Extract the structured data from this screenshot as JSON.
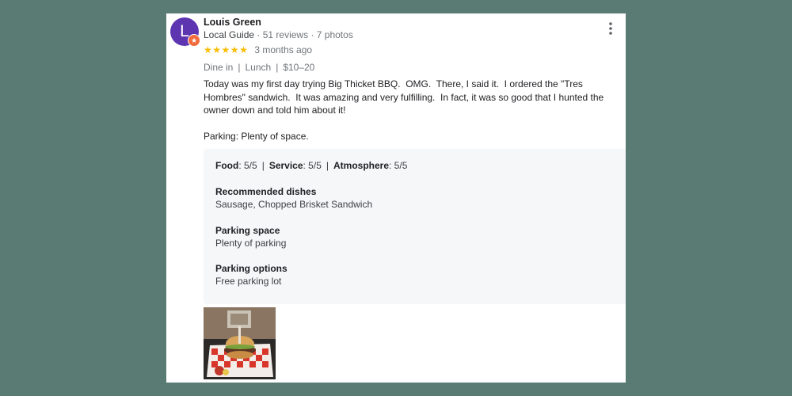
{
  "reviewer": {
    "name": "Louis Green",
    "avatar_letter": "L",
    "guide_label": "Local Guide",
    "separator1": "·",
    "reviews": "51 reviews",
    "separator2": "·",
    "photos": "7 photos"
  },
  "rating": {
    "stars": 5,
    "max_stars": 5,
    "time_ago": "3 months ago"
  },
  "tags": {
    "service": "Dine in",
    "meal": "Lunch",
    "price": "$10–20",
    "separator": "|"
  },
  "review_text": "Today was my first day trying Big Thicket BBQ.  OMG.  There, I said it.  I ordered the \"Tres Hombres\" sandwich.  It was amazing and very fulfilling.  In fact, it was so good that I hunted the owner down and told him about it!",
  "parking_note": "Parking: Plenty of space.",
  "scores": {
    "food_label": "Food",
    "food_value": ": 5/5",
    "service_label": "Service",
    "service_value": ": 5/5",
    "atmosphere_label": "Atmosphere",
    "atmosphere_value": ": 5/5",
    "separator": "|"
  },
  "details": [
    {
      "title": "Recommended dishes",
      "value": "Sausage, Chopped Brisket Sandwich"
    },
    {
      "title": "Parking space",
      "value": "Plenty of parking"
    },
    {
      "title": "Parking options",
      "value": "Free parking lot"
    }
  ],
  "icons": {
    "avatar": "avatar-letter",
    "guide_badge": "star-badge-icon",
    "more": "more-vert-icon",
    "star": "star-icon"
  },
  "colors": {
    "avatar_bg": "#5e35b1",
    "star": "#fbbc04",
    "badge": "#f26b3a",
    "page_bg": "#5a7b74"
  }
}
